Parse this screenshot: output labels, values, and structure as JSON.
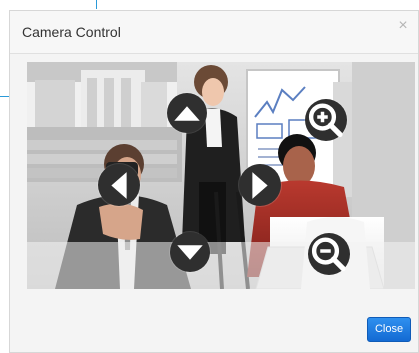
{
  "dialog": {
    "title": "Camera Control",
    "close_icon": "close-icon",
    "close_label": "Close"
  },
  "controls": {
    "up_icon": "chevron-up-icon",
    "down_icon": "chevron-down-icon",
    "left_icon": "chevron-left-icon",
    "right_icon": "chevron-right-icon",
    "zoom_in_icon": "zoom-in-icon",
    "zoom_out_icon": "zoom-out-icon"
  },
  "colors": {
    "accent": "#1a73d8",
    "control_bg": "#2f2f2f",
    "dialog_bg": "#f4f4f4",
    "annotation_line": "#2a9ad8"
  }
}
